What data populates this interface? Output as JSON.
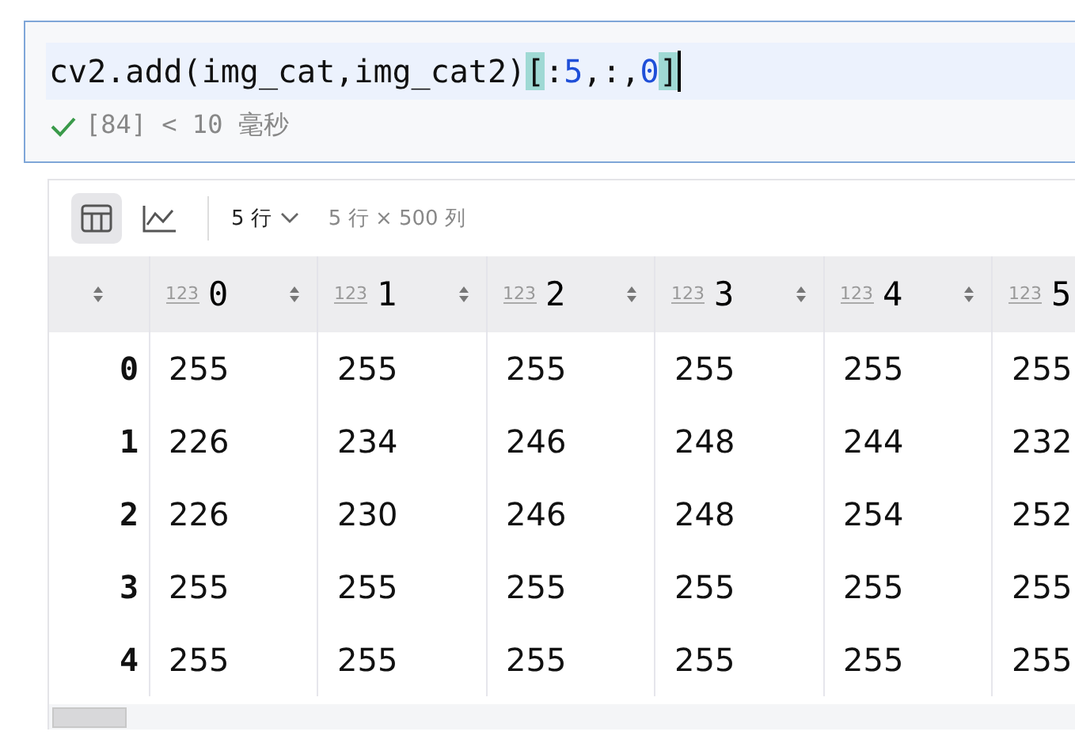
{
  "code": {
    "tokens": [
      {
        "text": "cv2.add(img_cat,img_cat2)",
        "kind": "plain"
      },
      {
        "text": "[",
        "kind": "bracket"
      },
      {
        "text": ":",
        "kind": "plain"
      },
      {
        "text": "5",
        "kind": "number"
      },
      {
        "text": ",:,",
        "kind": "plain"
      },
      {
        "text": "0",
        "kind": "number"
      },
      {
        "text": "]",
        "kind": "bracket"
      }
    ]
  },
  "status": {
    "success": true,
    "text": "[84] < 10 毫秒"
  },
  "toolbar": {
    "views": [
      {
        "kind": "table",
        "selected": true
      },
      {
        "kind": "chart",
        "selected": false
      }
    ],
    "rows_dropdown": "5 行",
    "shape": "5 行 × 500 列"
  },
  "table": {
    "columns": [
      {
        "type": "123",
        "label": "0"
      },
      {
        "type": "123",
        "label": "1"
      },
      {
        "type": "123",
        "label": "2"
      },
      {
        "type": "123",
        "label": "3"
      },
      {
        "type": "123",
        "label": "4"
      },
      {
        "type": "123",
        "label": "5"
      }
    ],
    "rows": [
      {
        "index": "0",
        "cells": [
          "255",
          "255",
          "255",
          "255",
          "255",
          "255"
        ]
      },
      {
        "index": "1",
        "cells": [
          "226",
          "234",
          "246",
          "248",
          "244",
          "232"
        ]
      },
      {
        "index": "2",
        "cells": [
          "226",
          "230",
          "246",
          "248",
          "254",
          "252"
        ]
      },
      {
        "index": "3",
        "cells": [
          "255",
          "255",
          "255",
          "255",
          "255",
          "255"
        ]
      },
      {
        "index": "4",
        "cells": [
          "255",
          "255",
          "255",
          "255",
          "255",
          "255"
        ]
      }
    ]
  }
}
